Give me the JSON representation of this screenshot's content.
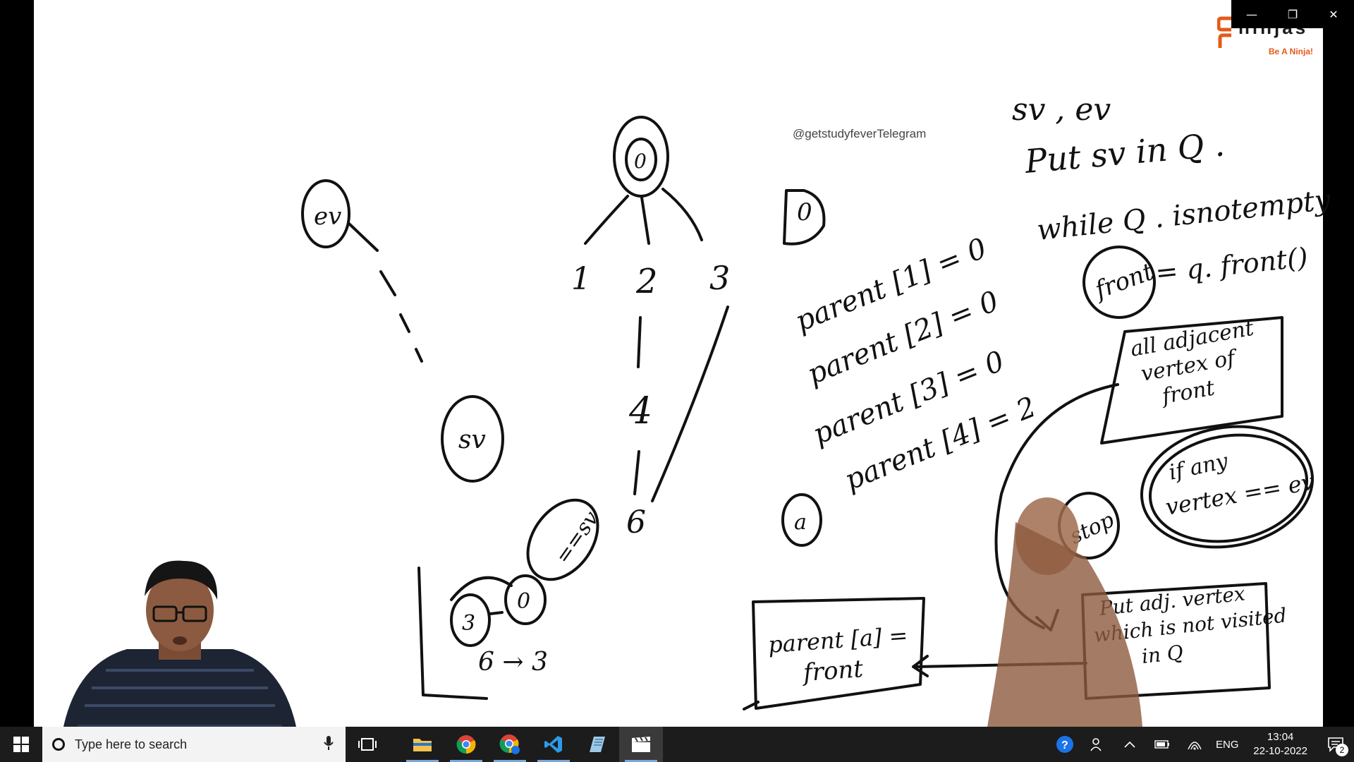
{
  "video": {
    "watermark": "@getstudyfeverTelegram",
    "logo": {
      "name": "ninjas",
      "tagline": "Be A Ninja!"
    },
    "window_controls": {
      "minimize": "—",
      "restore": "❐",
      "close": "✕"
    },
    "whiteboard": {
      "left_node": "ev",
      "sv_node": "sv",
      "tree_root": "0",
      "tree_children": [
        "1",
        "2",
        "3"
      ],
      "tree_mid": "4",
      "tree_bottom": "6",
      "queue_nodes": [
        "3",
        "0"
      ],
      "queue_check": "==sv",
      "queue_trace": "6 → 3",
      "single_node": "0",
      "a_node": "a",
      "parent_lines": [
        "parent [1] = 0",
        "parent [2] = 0",
        "parent [3] = 0",
        "parent [4] = 2"
      ],
      "algo_line1": "sv , ev",
      "algo_line2": "Put sv in Q .",
      "algo_line3": "while Q . isnotempty",
      "front_label": "front",
      "algo_line4": "= q. front()",
      "box_adj": "all adjacent vertex of front",
      "box_if": "if any vertex == ev",
      "stop_label": "stop",
      "box_put": "Put adj. vertex which is not visited in Q",
      "box_parent_line1": "parent [a] =",
      "box_parent_line2": "front"
    }
  },
  "taskbar": {
    "search_placeholder": "Type here to search",
    "apps": [
      {
        "name": "file-explorer"
      },
      {
        "name": "chrome"
      },
      {
        "name": "chrome-profile"
      },
      {
        "name": "vscode"
      },
      {
        "name": "notepad"
      },
      {
        "name": "video-app"
      }
    ],
    "tray": {
      "language": "ENG",
      "time": "13:04",
      "date": "22-10-2022",
      "notification_count": "2"
    }
  }
}
